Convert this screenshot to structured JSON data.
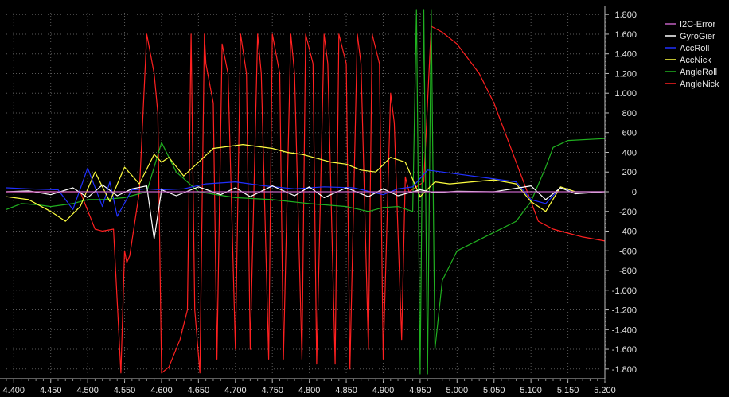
{
  "chart_data": {
    "type": "line",
    "title": "",
    "xlabel": "",
    "ylabel": "",
    "xlim": [
      4.39,
      5.2
    ],
    "ylim": [
      -1850,
      1850
    ],
    "grid": true,
    "legend_position": "top-right",
    "x_ticks": [
      "4.400",
      "4.450",
      "4.500",
      "4.550",
      "4.600",
      "4.650",
      "4.700",
      "4.750",
      "4.800",
      "4.850",
      "4.900",
      "4.950",
      "5.000",
      "5.050",
      "5.100",
      "5.150",
      "5.200"
    ],
    "y_ticks": [
      "1.800",
      "1.600",
      "1.400",
      "1.200",
      "1.000",
      "800",
      "600",
      "400",
      "200",
      "0",
      "-200",
      "-400",
      "-600",
      "-800",
      "-1.000",
      "-1.200",
      "-1.400",
      "-1.600",
      "-1.800"
    ],
    "series": [
      {
        "name": "I2C-Error",
        "color": "#c060c0",
        "x": [
          4.39,
          4.6,
          4.8,
          5.0,
          5.2
        ],
        "y": [
          0,
          0,
          0,
          0,
          0
        ]
      },
      {
        "name": "GyroGier",
        "color": "#ffffff",
        "x": [
          4.39,
          4.42,
          4.45,
          4.48,
          4.5,
          4.52,
          4.54,
          4.56,
          4.58,
          4.59,
          4.6,
          4.62,
          4.65,
          4.68,
          4.7,
          4.72,
          4.75,
          4.78,
          4.8,
          4.82,
          4.85,
          4.88,
          4.9,
          4.92,
          4.95,
          4.97,
          5.0,
          5.05,
          5.1,
          5.12,
          5.14,
          5.16,
          5.2
        ],
        "y": [
          0,
          10,
          -30,
          40,
          -60,
          70,
          -40,
          30,
          60,
          -480,
          20,
          -40,
          50,
          -30,
          40,
          -50,
          60,
          -40,
          50,
          -60,
          40,
          -50,
          30,
          -40,
          20,
          -10,
          5,
          0,
          60,
          -80,
          40,
          -20,
          0
        ]
      },
      {
        "name": "AccRoll",
        "color": "#2030ff",
        "x": [
          4.39,
          4.42,
          4.46,
          4.48,
          4.5,
          4.52,
          4.53,
          4.54,
          4.56,
          4.58,
          4.6,
          4.63,
          4.66,
          4.7,
          4.74,
          4.78,
          4.82,
          4.86,
          4.9,
          4.92,
          4.94,
          4.96,
          4.98,
          5.0,
          5.03,
          5.06,
          5.08,
          5.1,
          5.12,
          5.14,
          5.16,
          5.2
        ],
        "y": [
          40,
          30,
          20,
          -180,
          240,
          -150,
          100,
          -250,
          20,
          30,
          20,
          30,
          80,
          100,
          60,
          30,
          50,
          40,
          -30,
          30,
          50,
          220,
          200,
          180,
          150,
          120,
          100,
          -80,
          -120,
          40,
          0,
          0
        ]
      },
      {
        "name": "AccNick",
        "color": "#ffff40",
        "x": [
          4.39,
          4.42,
          4.45,
          4.47,
          4.49,
          4.51,
          4.53,
          4.55,
          4.57,
          4.59,
          4.6,
          4.61,
          4.63,
          4.65,
          4.67,
          4.69,
          4.71,
          4.73,
          4.75,
          4.77,
          4.79,
          4.81,
          4.83,
          4.85,
          4.87,
          4.89,
          4.91,
          4.93,
          4.95,
          4.97,
          4.99,
          5.02,
          5.05,
          5.08,
          5.1,
          5.12,
          5.14,
          5.16,
          5.2
        ],
        "y": [
          -50,
          -80,
          -200,
          -300,
          -150,
          200,
          -100,
          250,
          80,
          380,
          300,
          350,
          160,
          300,
          440,
          460,
          480,
          460,
          440,
          400,
          380,
          340,
          300,
          280,
          220,
          200,
          350,
          300,
          -50,
          100,
          80,
          100,
          120,
          80,
          -100,
          -200,
          50,
          0,
          0
        ]
      },
      {
        "name": "AngleRoll",
        "color": "#20b020",
        "x": [
          4.39,
          4.41,
          4.43,
          4.45,
          4.48,
          4.5,
          4.52,
          4.55,
          4.58,
          4.6,
          4.62,
          4.65,
          4.7,
          4.75,
          4.8,
          4.85,
          4.88,
          4.9,
          4.92,
          4.94,
          4.945,
          4.95,
          4.955,
          4.96,
          4.965,
          4.97,
          4.98,
          5.0,
          5.04,
          5.08,
          5.1,
          5.12,
          5.13,
          5.15,
          5.2
        ],
        "y": [
          -180,
          -120,
          -130,
          -150,
          -120,
          -80,
          -80,
          -60,
          0,
          500,
          200,
          0,
          -60,
          -80,
          -120,
          -150,
          -200,
          -160,
          -150,
          -200,
          1850,
          -1850,
          1850,
          -1850,
          1850,
          -1600,
          -900,
          -600,
          -450,
          -300,
          -100,
          250,
          450,
          520,
          540
        ]
      },
      {
        "name": "AngleNick",
        "color": "#ff2020",
        "x": [
          4.39,
          4.43,
          4.46,
          4.49,
          4.51,
          4.52,
          4.535,
          4.545,
          4.55,
          4.553,
          4.557,
          4.56,
          4.57,
          4.58,
          4.59,
          4.595,
          4.6,
          4.61,
          4.625,
          4.635,
          4.64,
          4.645,
          4.652,
          4.658,
          4.66,
          4.67,
          4.675,
          4.682,
          4.69,
          4.7,
          4.707,
          4.715,
          4.72,
          4.73,
          4.735,
          4.745,
          4.75,
          4.76,
          4.765,
          4.775,
          4.78,
          4.79,
          4.795,
          4.805,
          4.81,
          4.82,
          4.825,
          4.835,
          4.84,
          4.85,
          4.855,
          4.865,
          4.87,
          4.88,
          4.885,
          4.895,
          4.9,
          4.91,
          4.915,
          4.925,
          4.93,
          4.935,
          4.955,
          4.965,
          4.98,
          5.0,
          5.03,
          5.05,
          5.08,
          5.1,
          5.105,
          5.11,
          5.13,
          5.15,
          5.17,
          5.2
        ],
        "y": [
          0,
          0,
          0,
          0,
          -380,
          -400,
          -380,
          -1840,
          -600,
          -720,
          -650,
          -500,
          0,
          1600,
          1200,
          800,
          -1840,
          -1780,
          -1500,
          -1200,
          1600,
          -1200,
          -1840,
          1600,
          1300,
          900,
          -1700,
          1500,
          1200,
          -1600,
          1600,
          1200,
          -1600,
          1600,
          1200,
          -1700,
          1600,
          1200,
          -1700,
          1600,
          1200,
          -1700,
          1600,
          1300,
          -1750,
          1600,
          1300,
          -1750,
          1600,
          1300,
          -1800,
          1600,
          1300,
          -1600,
          1600,
          1300,
          -1700,
          1000,
          700,
          -1500,
          150,
          0,
          100,
          1680,
          1620,
          1500,
          1200,
          900,
          300,
          -100,
          -200,
          -300,
          -380,
          -420,
          -460,
          -500
        ]
      }
    ]
  }
}
